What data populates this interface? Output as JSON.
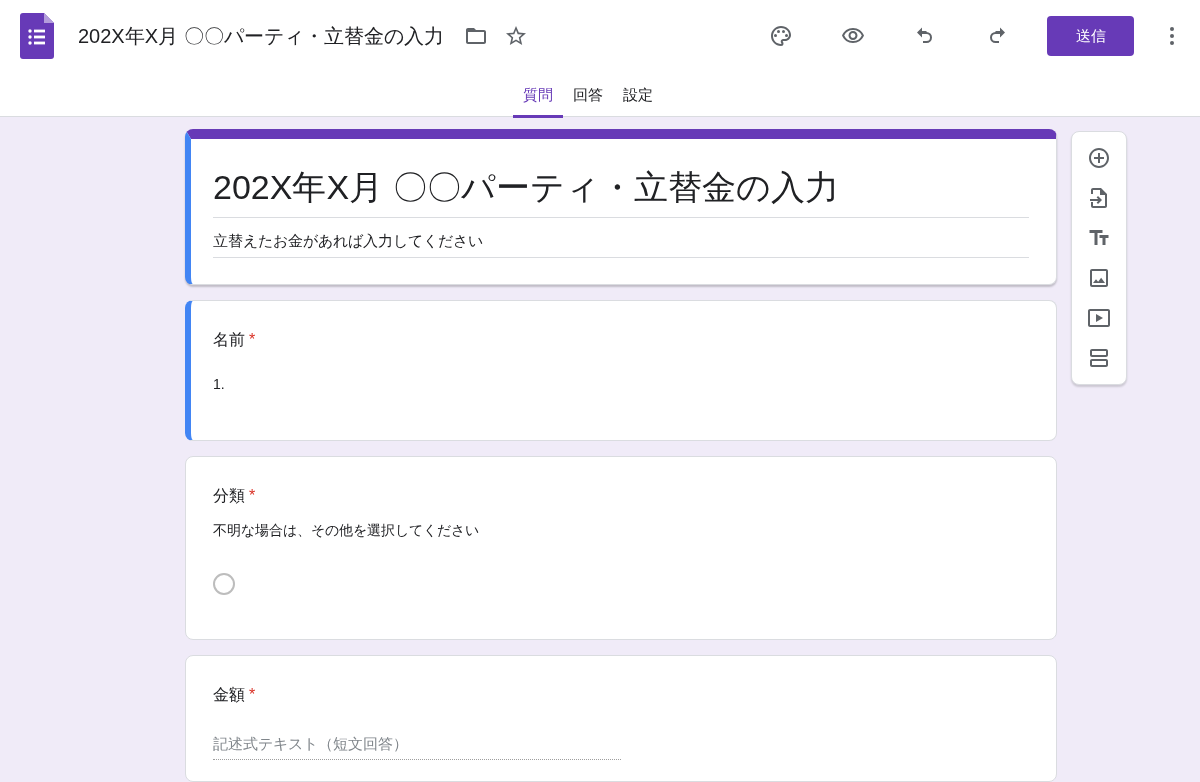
{
  "header": {
    "title": "202X年X月 〇〇パーティ・立替金の入力",
    "send_button": "送信"
  },
  "tabs": [
    {
      "label": "質問",
      "selected": true
    },
    {
      "label": "回答",
      "selected": false
    },
    {
      "label": "設定",
      "selected": false
    }
  ],
  "form": {
    "title": "202X年X月 〇〇パーティ・立替金の入力",
    "description": "立替えたお金があれば入力してください"
  },
  "questions": [
    {
      "kind": "list",
      "title": "名前",
      "required_mark": "*",
      "active": true,
      "item": "1."
    },
    {
      "kind": "radio",
      "title": "分類",
      "required_mark": "*",
      "active": false,
      "description": "不明な場合は、その他を選択してください",
      "checked": false
    },
    {
      "kind": "short",
      "title": "金額",
      "required_mark": "*",
      "active": false,
      "placeholder": "記述式テキスト（短文回答）"
    }
  ]
}
